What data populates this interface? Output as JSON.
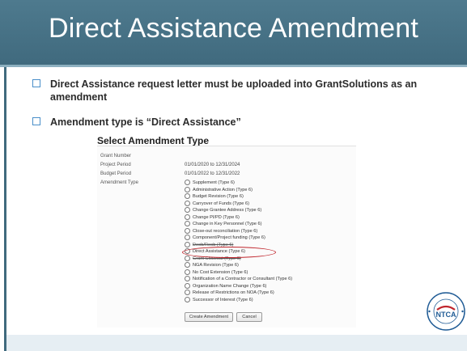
{
  "slide": {
    "title": "Direct Assistance Amendment",
    "bullets": [
      "Direct Assistance request letter must be uploaded into GrantSolutions as an amendment",
      "Amendment type is “Direct Assistance”"
    ]
  },
  "form": {
    "heading": "Select Amendment Type",
    "fields": [
      {
        "label": "Grant Number",
        "value": ""
      },
      {
        "label": "Project Period",
        "value": "01/01/2020  to  12/31/2024"
      },
      {
        "label": "Budget Period",
        "value": "01/01/2022  to  12/31/2022"
      },
      {
        "label": "Amendment Type",
        "value": ""
      }
    ],
    "options": [
      "Supplement (Type 6)",
      "Administrative Action (Type 6)",
      "Budget Revision (Type 6)",
      "Carryover of Funds (Type 6)",
      "Change Grantee Address (Type 6)",
      "Change PI/PD (Type 6)",
      "Change in Key Personnel (Type 6)",
      "Close-out reconciliation (Type 6)",
      "Component/Project funding (Type 6)",
      "Deob/Reob (Type 6)",
      "Direct Assistance (Type 6)",
      "Grant Closeout (Type 6)",
      "NGA Revision (Type 6)",
      "No Cost Extension (Type 6)",
      "Notification of a Contractor or Consultant (Type 6)",
      "Organization Name Change (Type 6)",
      "Release of Restrictions on NOA (Type 6)",
      "Successor of Interest (Type 6)"
    ],
    "buttons": {
      "create": "Create Amendment",
      "cancel": "Cancel"
    }
  },
  "logo": {
    "text": "NTCA",
    "ring_text": "NATIONAL TUBERCULOSIS CONTROLLERS ASSOCIATION"
  },
  "colors": {
    "title_bar": "#406a7e",
    "bullet_box": "#4a8fc9",
    "highlight_oval": "#c0262d",
    "logo_red": "#c0262d",
    "logo_blue": "#1f5b95"
  }
}
